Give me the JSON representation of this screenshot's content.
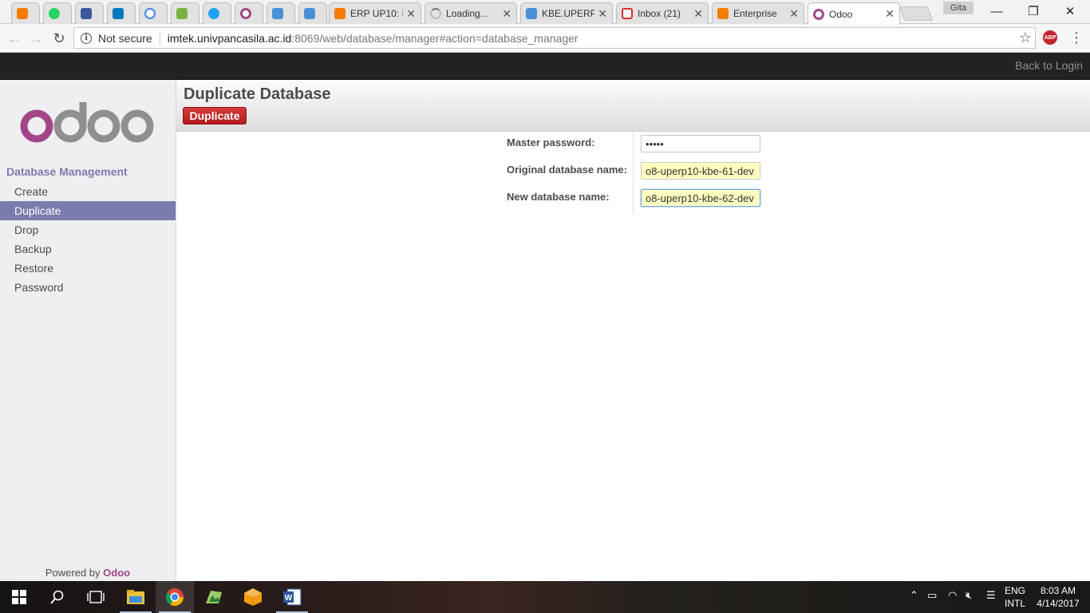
{
  "browser": {
    "tabs": [
      {
        "label": "",
        "icon": "blogger-icon",
        "color": "#f57c00"
      },
      {
        "label": "",
        "icon": "whatsapp-icon",
        "color": "#25d366"
      },
      {
        "label": "",
        "icon": "facebook-icon",
        "color": "#3b5998"
      },
      {
        "label": "",
        "icon": "trello-icon",
        "color": "#0079bf"
      },
      {
        "label": "",
        "icon": "google-icon",
        "color": "#4285f4"
      },
      {
        "label": "",
        "icon": "package-icon",
        "color": "#7cb342"
      },
      {
        "label": "",
        "icon": "twitter-icon",
        "color": "#1da1f2"
      },
      {
        "label": "",
        "icon": "odoo-icon",
        "color": "#a24689"
      },
      {
        "label": "",
        "icon": "graduation-cap-icon",
        "color": "#4a90d9"
      },
      {
        "label": "",
        "icon": "graduation-cap-icon",
        "color": "#4a90d9"
      },
      {
        "label": "ERP UP10: I",
        "icon": "blogger-icon",
        "color": "#f57c00"
      },
      {
        "label": "Loading...",
        "icon": "loading-spinner-icon",
        "color": "#999999"
      },
      {
        "label": "KBE.UPERP",
        "icon": "graduation-cap-icon",
        "color": "#4a90d9"
      },
      {
        "label": "Inbox (21)",
        "icon": "gmail-icon",
        "color": "#d93025"
      },
      {
        "label": "Enterprise",
        "icon": "blogger-icon",
        "color": "#f57c00"
      },
      {
        "label": "Odoo",
        "icon": "odoo-icon",
        "color": "#a24689",
        "active": true
      }
    ],
    "profile": "Gita",
    "window_controls": {
      "minimize": "—",
      "restore": "❐",
      "close": "✕"
    },
    "address": {
      "security": "Not secure",
      "host": "imtek.univpancasila.ac.id",
      "path": ":8069/web/database/manager#action=database_manager"
    },
    "extension": "ABP"
  },
  "topbar": {
    "back_to_login": "Back to Login"
  },
  "sidebar": {
    "section": "Database Management",
    "items": [
      "Create",
      "Duplicate",
      "Drop",
      "Backup",
      "Restore",
      "Password"
    ],
    "active_item": "Duplicate",
    "powered_prefix": "Powered by",
    "powered_brand": "Odoo"
  },
  "main": {
    "title": "Duplicate Database",
    "action_button": "Duplicate",
    "fields": {
      "master_password": {
        "label": "Master password:",
        "value": "•••••"
      },
      "original_db": {
        "label": "Original database name:",
        "value": "o8-uperp10-kbe-61-dev"
      },
      "new_db": {
        "label": "New database name:",
        "value": "o8-uperp10-kbe-62-dev"
      }
    }
  },
  "taskbar": {
    "apps": [
      "start-icon",
      "search-icon",
      "task-view-icon",
      "file-explorer-icon",
      "chrome-icon",
      "photos-icon",
      "box-app-icon",
      "word-icon"
    ],
    "language": "ENG",
    "layout": "INTL",
    "time": "8:03 AM",
    "date": "4/14/2017"
  },
  "colors": {
    "odoo_purple": "#7c7bad",
    "odoo_brand": "#a24689",
    "danger": "#c0282a",
    "required_field": "#ffffc0"
  }
}
